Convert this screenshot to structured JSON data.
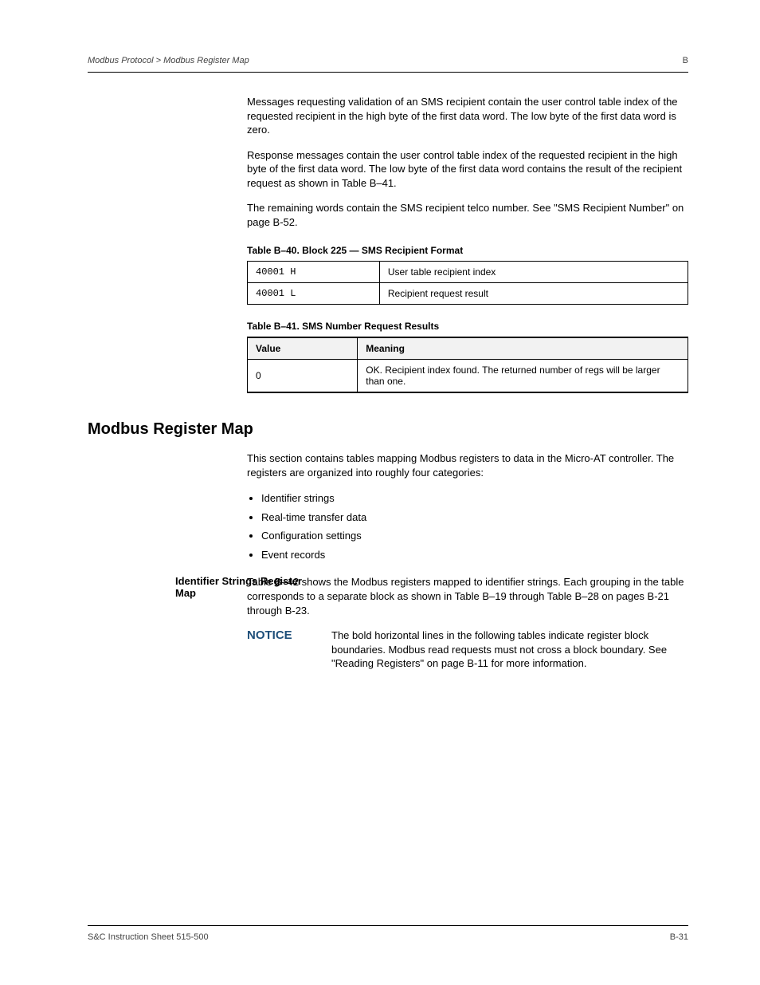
{
  "header": {
    "section_path": "Modbus Protocol > Modbus Register Map",
    "page_label": "B"
  },
  "intro": {
    "p1": "Messages requesting validation of an SMS recipient contain the user control table index of the requested recipient in the high byte of the first data word. The low byte of the first data word is zero.",
    "p2": "Response messages contain the user control table index of the requested recipient in the high byte of the first data word. The low byte of the first data word contains the result of the recipient request as shown in Table B–41.",
    "p3": "The remaining words contain the SMS recipient telco number. See \"SMS Recipient Number\" on page B-52."
  },
  "table1": {
    "caption": "Table B–40. Block 225 — SMS Recipient Format",
    "rows": [
      {
        "c1": "40001 H",
        "c2": "User table recipient index"
      },
      {
        "c1": "40001 L",
        "c2": "Recipient request result"
      }
    ]
  },
  "table2": {
    "caption": "Table B–41. SMS Number Request Results",
    "head": [
      "Value",
      "Meaning"
    ],
    "rows": [
      {
        "c1": "0",
        "c2": "OK. Recipient index found. The returned number of regs will be larger than one."
      }
    ]
  },
  "section": {
    "title": "Modbus Register Map",
    "para": "This section contains tables mapping Modbus registers to data in the Micro-AT controller. The registers are organized into roughly four categories:",
    "bullets": [
      "Identifier strings",
      "Real-time transfer data",
      "Configuration settings",
      "Event records"
    ]
  },
  "subheads": {
    "id_strings": "Identifier Strings Register Map",
    "id_strings_para": "Table B–42 shows the Modbus registers mapped to identifier strings. Each grouping in the table corresponds to a separate block as shown in Table B–19 through Table B–28 on pages B-21 through B-23."
  },
  "notice": {
    "label": "NOTICE",
    "text": "The bold horizontal lines in the following tables indicate register block boundaries. Modbus read requests must not cross a block boundary. See \"Reading Registers\" on page B-11 for more information."
  },
  "footer": {
    "left": "S&C Instruction Sheet 515-500",
    "right": "B-31"
  }
}
